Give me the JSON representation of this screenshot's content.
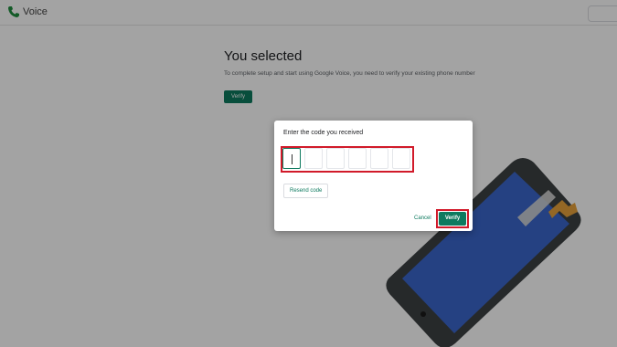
{
  "app": {
    "name": "Voice"
  },
  "page": {
    "title": "You selected",
    "description": "To complete setup and start using Google Voice, you need to verify your existing phone number",
    "verify_label": "Verify"
  },
  "dialog": {
    "title": "Enter the code you received",
    "code_digits": [
      "",
      "",
      "",
      "",
      "",
      ""
    ],
    "resend_label": "Resend code",
    "cancel_label": "Cancel",
    "verify_label": "Verify"
  },
  "colors": {
    "accent": "#0d7a5f",
    "highlight": "#d11a2a",
    "screen": "#3a66cc"
  }
}
